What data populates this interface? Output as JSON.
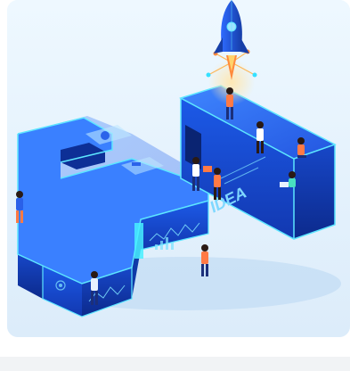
{
  "illustration": {
    "wall_text": "IDEA",
    "colors": {
      "background": "#e7f4fd",
      "block_top": "#2d6bf0",
      "block_front": "#1548c9",
      "block_side": "#0f36a3",
      "neon": "#35e0ff",
      "rocket": "#1f4fd6",
      "flame": "#ff8a3d"
    }
  }
}
